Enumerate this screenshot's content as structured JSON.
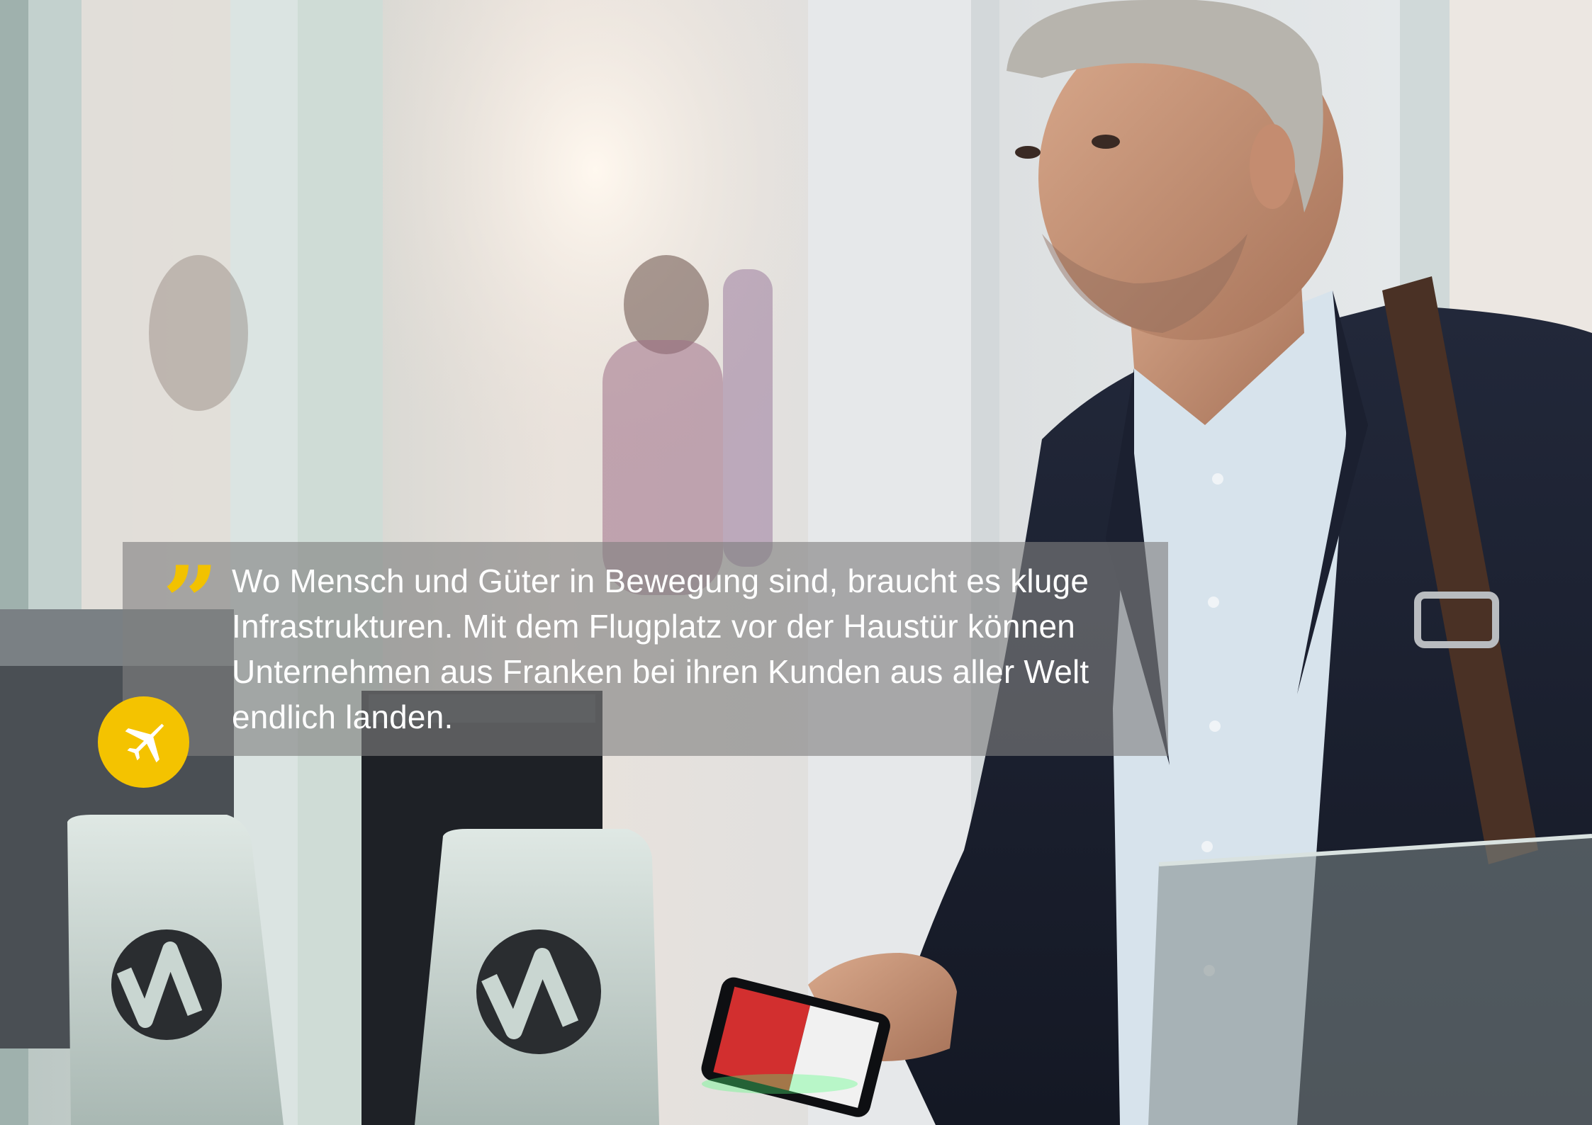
{
  "quote": {
    "text": "Wo Mensch und Güter in Bewegung sind, braucht es kluge Infrastrukturen. Mit dem Flugplatz vor der Haustür können Unternehmen aus Franken bei ihren Kunden aus aller Welt endlich landen.",
    "mark": "”"
  },
  "badge": {
    "icon": "airplane-icon",
    "color": "#f4c300"
  },
  "colors": {
    "accent_yellow": "#f2c200",
    "quote_panel": "#808080"
  }
}
